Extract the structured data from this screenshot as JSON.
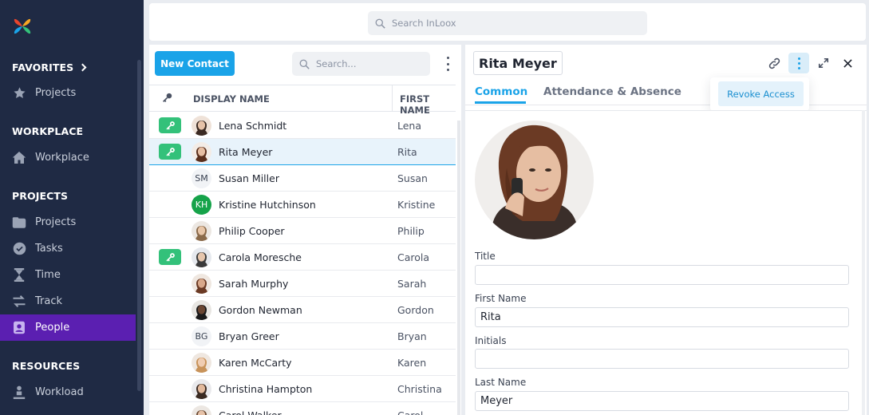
{
  "sidebar": {
    "favorites_label": "FAVORITES",
    "favorites_items": [
      {
        "label": "Projects",
        "icon": "star-icon"
      }
    ],
    "workplace_label": "WORKPLACE",
    "workplace_items": [
      {
        "label": "Workplace",
        "icon": "home-icon"
      }
    ],
    "projects_label": "PROJECTS",
    "projects_items": [
      {
        "label": "Projects",
        "icon": "folder-icon"
      },
      {
        "label": "Tasks",
        "icon": "check-circle-icon"
      },
      {
        "label": "Time",
        "icon": "hourglass-icon"
      },
      {
        "label": "Track",
        "icon": "swap-icon"
      },
      {
        "label": "People",
        "icon": "contacts-icon",
        "active": true
      }
    ],
    "resources_label": "RESOURCES",
    "resources_items": [
      {
        "label": "Workload",
        "icon": "person-workload-icon"
      }
    ],
    "active_color": "#5b1fb1"
  },
  "topbar": {
    "search_placeholder": "Search InLoox"
  },
  "list": {
    "new_button": "New Contact",
    "search_placeholder": "Search...",
    "columns": {
      "display_name": "DISPLAY NAME",
      "first_name": "FIRST NAME"
    },
    "rows": [
      {
        "display_name": "Lena Schmidt",
        "first_name": "Lena",
        "has_key": true,
        "avatar": "photo"
      },
      {
        "display_name": "Rita Meyer",
        "first_name": "Rita",
        "has_key": true,
        "avatar": "photo",
        "selected": true
      },
      {
        "display_name": "Susan Miller",
        "first_name": "Susan",
        "has_key": false,
        "initials": "SM"
      },
      {
        "display_name": "Kristine Hutchinson",
        "first_name": "Kristine",
        "has_key": false,
        "initials": "KH"
      },
      {
        "display_name": "Philip Cooper",
        "first_name": "Philip",
        "has_key": false,
        "avatar": "photo"
      },
      {
        "display_name": "Carola Moresche",
        "first_name": "Carola",
        "has_key": true,
        "avatar": "photo"
      },
      {
        "display_name": "Sarah Murphy",
        "first_name": "Sarah",
        "has_key": false,
        "avatar": "photo"
      },
      {
        "display_name": "Gordon Newman",
        "first_name": "Gordon",
        "has_key": false,
        "avatar": "photo"
      },
      {
        "display_name": "Bryan Greer",
        "first_name": "Bryan",
        "has_key": false,
        "initials": "BG"
      },
      {
        "display_name": "Karen McCarty",
        "first_name": "Karen",
        "has_key": false,
        "avatar": "photo"
      },
      {
        "display_name": "Christina Hampton",
        "first_name": "Christina",
        "has_key": false,
        "avatar": "photo"
      },
      {
        "display_name": "Carol Walker",
        "first_name": "Carol",
        "has_key": false,
        "avatar": "photo"
      }
    ]
  },
  "detail": {
    "title": "Rita Meyer",
    "tabs": [
      "Common",
      "Attendance & Absence"
    ],
    "menu_item": "Revoke Access",
    "fields": [
      {
        "label": "Title",
        "value": ""
      },
      {
        "label": "First Name",
        "value": "Rita"
      },
      {
        "label": "Initials",
        "value": ""
      },
      {
        "label": "Last Name",
        "value": "Meyer"
      }
    ]
  }
}
